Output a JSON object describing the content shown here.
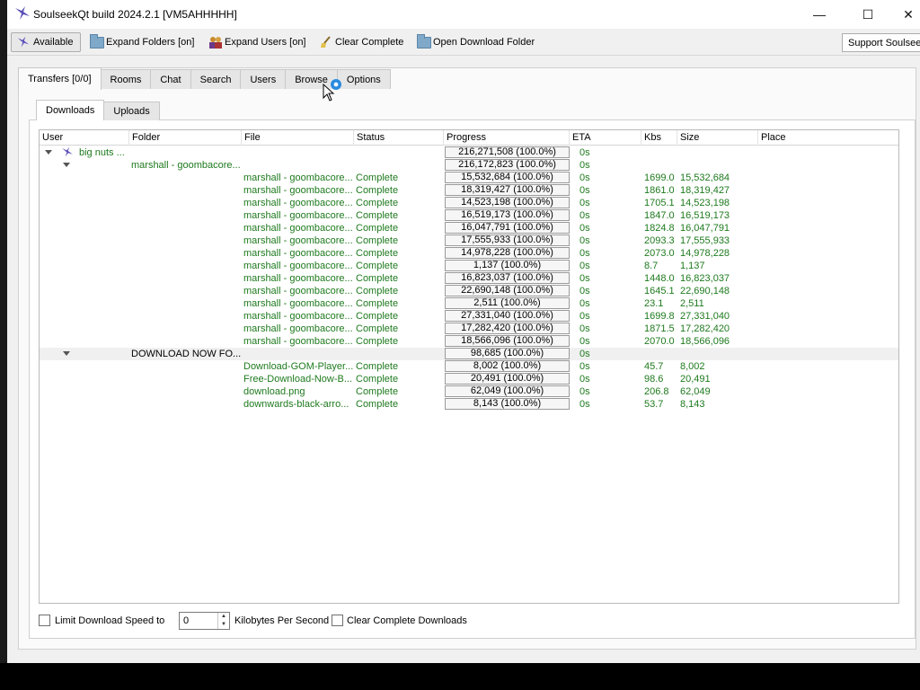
{
  "window": {
    "title": "SoulseekQt build 2024.2.1 [VM5AHHHHH]",
    "minimize": "—",
    "maximize": "☐",
    "close": "✕"
  },
  "toolbar": {
    "available": "Available",
    "expand_folders": "Expand Folders [on]",
    "expand_users": "Expand Users [on]",
    "clear_complete": "Clear Complete",
    "open_download_folder": "Open Download Folder",
    "support": "Support Soulseek"
  },
  "tabs": [
    "Transfers [0/0]",
    "Rooms",
    "Chat",
    "Search",
    "Users",
    "Browse",
    "Options"
  ],
  "subtabs": [
    "Downloads",
    "Uploads"
  ],
  "columns": [
    "User",
    "Folder",
    "File",
    "Status",
    "Progress",
    "ETA",
    "Kbs",
    "Size",
    "Place"
  ],
  "rows": [
    {
      "kind": "user",
      "user": "big nuts ...",
      "progress": "216,271,508 (100.0%)",
      "eta": "0s"
    },
    {
      "kind": "folder",
      "folder": "marshall - goombacore...",
      "progress": "216,172,823 (100.0%)",
      "eta": "0s"
    },
    {
      "kind": "file",
      "file": "marshall - goombacore...",
      "status": "Complete",
      "progress": "15,532,684 (100.0%)",
      "eta": "0s",
      "kbs": "1699.0",
      "size": "15,532,684"
    },
    {
      "kind": "file",
      "file": "marshall - goombacore...",
      "status": "Complete",
      "progress": "18,319,427 (100.0%)",
      "eta": "0s",
      "kbs": "1861.0",
      "size": "18,319,427"
    },
    {
      "kind": "file",
      "file": "marshall - goombacore...",
      "status": "Complete",
      "progress": "14,523,198 (100.0%)",
      "eta": "0s",
      "kbs": "1705.1",
      "size": "14,523,198"
    },
    {
      "kind": "file",
      "file": "marshall - goombacore...",
      "status": "Complete",
      "progress": "16,519,173 (100.0%)",
      "eta": "0s",
      "kbs": "1847.0",
      "size": "16,519,173"
    },
    {
      "kind": "file",
      "file": "marshall - goombacore...",
      "status": "Complete",
      "progress": "16,047,791 (100.0%)",
      "eta": "0s",
      "kbs": "1824.8",
      "size": "16,047,791"
    },
    {
      "kind": "file",
      "file": "marshall - goombacore...",
      "status": "Complete",
      "progress": "17,555,933 (100.0%)",
      "eta": "0s",
      "kbs": "2093.3",
      "size": "17,555,933"
    },
    {
      "kind": "file",
      "file": "marshall - goombacore...",
      "status": "Complete",
      "progress": "14,978,228 (100.0%)",
      "eta": "0s",
      "kbs": "2073.0",
      "size": "14,978,228"
    },
    {
      "kind": "file",
      "file": "marshall - goombacore...",
      "status": "Complete",
      "progress": "1,137 (100.0%)",
      "eta": "0s",
      "kbs": "8.7",
      "size": "1,137"
    },
    {
      "kind": "file",
      "file": "marshall - goombacore...",
      "status": "Complete",
      "progress": "16,823,037 (100.0%)",
      "eta": "0s",
      "kbs": "1448.0",
      "size": "16,823,037"
    },
    {
      "kind": "file",
      "file": "marshall - goombacore...",
      "status": "Complete",
      "progress": "22,690,148 (100.0%)",
      "eta": "0s",
      "kbs": "1645.1",
      "size": "22,690,148"
    },
    {
      "kind": "file",
      "file": "marshall - goombacore...",
      "status": "Complete",
      "progress": "2,511 (100.0%)",
      "eta": "0s",
      "kbs": "23.1",
      "size": "2,511"
    },
    {
      "kind": "file",
      "file": "marshall - goombacore...",
      "status": "Complete",
      "progress": "27,331,040 (100.0%)",
      "eta": "0s",
      "kbs": "1699.8",
      "size": "27,331,040"
    },
    {
      "kind": "file",
      "file": "marshall - goombacore...",
      "status": "Complete",
      "progress": "17,282,420 (100.0%)",
      "eta": "0s",
      "kbs": "1871.5",
      "size": "17,282,420"
    },
    {
      "kind": "file",
      "file": "marshall - goombacore...",
      "status": "Complete",
      "progress": "18,566,096 (100.0%)",
      "eta": "0s",
      "kbs": "2070.0",
      "size": "18,566,096"
    },
    {
      "kind": "folder2",
      "folder": "DOWNLOAD NOW FO...",
      "progress": "98,685 (100.0%)",
      "eta": "0s"
    },
    {
      "kind": "file",
      "file": "Download-GOM-Player...",
      "status": "Complete",
      "progress": "8,002 (100.0%)",
      "eta": "0s",
      "kbs": "45.7",
      "size": "8,002"
    },
    {
      "kind": "file",
      "file": "Free-Download-Now-B...",
      "status": "Complete",
      "progress": "20,491 (100.0%)",
      "eta": "0s",
      "kbs": "98.6",
      "size": "20,491"
    },
    {
      "kind": "file",
      "file": "download.png",
      "status": "Complete",
      "progress": "62,049 (100.0%)",
      "eta": "0s",
      "kbs": "206.8",
      "size": "62,049"
    },
    {
      "kind": "file",
      "file": "downwards-black-arro...",
      "status": "Complete",
      "progress": "8,143 (100.0%)",
      "eta": "0s",
      "kbs": "53.7",
      "size": "8,143"
    }
  ],
  "footer": {
    "limit_label": "Limit Download Speed to",
    "speed_value": "0",
    "unit_label": "Kilobytes Per Second",
    "clear_label": "Clear Complete Downloads"
  },
  "colors": {
    "complete_text": "#1e7a1e",
    "accent": "#2a8be0"
  }
}
